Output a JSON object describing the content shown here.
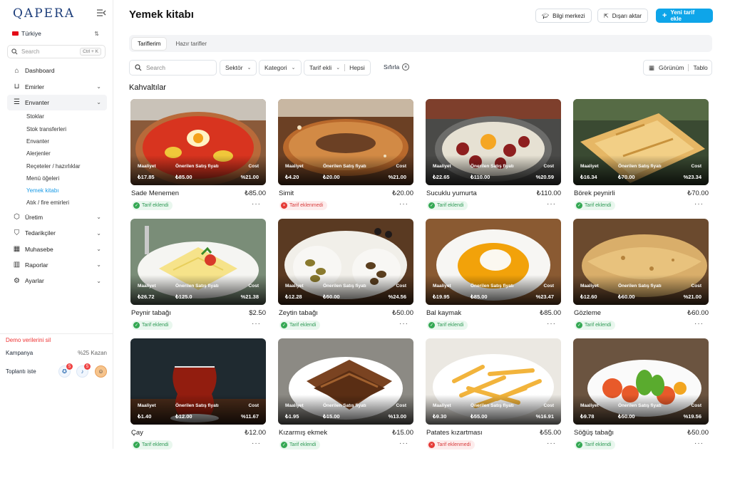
{
  "app": {
    "logo": "QAPERA"
  },
  "sidebar": {
    "country": "Türkiye",
    "search_placeholder": "Search",
    "search_shortcut": "Ctrl + K",
    "items": [
      {
        "label": "Dashboard",
        "icon": "home-icon",
        "chevron": false
      },
      {
        "label": "Emirler",
        "icon": "basket-icon",
        "chevron": true
      },
      {
        "label": "Envanter",
        "icon": "inventory-icon",
        "chevron": true,
        "expanded": true
      }
    ],
    "subitems": [
      "Stoklar",
      "Stok transferleri",
      "Envanter",
      "Alerjenler",
      "Reçeteler / hazırlıklar",
      "Menü öğeleri",
      "Yemek kitabı",
      "Atık / fire emirleri"
    ],
    "selected_sub": "Yemek kitabı",
    "items_after": [
      {
        "label": "Üretim",
        "icon": "box-icon"
      },
      {
        "label": "Tedarikçiler",
        "icon": "supplier-icon"
      },
      {
        "label": "Muhasebe",
        "icon": "calculator-icon"
      },
      {
        "label": "Raporlar",
        "icon": "chart-icon"
      },
      {
        "label": "Ayarlar",
        "icon": "gear-icon"
      }
    ],
    "demo_label": "Demo verilerini sil",
    "campaign_label": "Kampanya",
    "campaign_value": "%25 Kazan",
    "meeting_label": "Toplantı iste",
    "badge_award": "5",
    "badge_bell": "5"
  },
  "header": {
    "title": "Yemek kitabı",
    "btn_info": "Bilgi merkezi",
    "btn_export": "Dışarı aktar",
    "btn_new": "Yeni tarif ekle"
  },
  "tabs": [
    "Tariflerim",
    "Hazır tarifler"
  ],
  "filters": {
    "search_placeholder": "Search",
    "sector": "Sektör",
    "category": "Kategori",
    "recipe_added": "Tarif ekli",
    "recipe_added_value": "Hepsi",
    "reset": "Sıfırla",
    "view": "Görünüm",
    "view_value": "Tablo"
  },
  "section": "Kahvaltılar",
  "metric_labels": {
    "cost_tr": "Maaliyet",
    "suggested": "Önerilen Satış fiyatı",
    "cost_pct": "Cost"
  },
  "colors": {
    "accent": "#0ea5e9",
    "ok": "#34a853",
    "error": "#e53935"
  },
  "recipes": [
    {
      "name": "Sade Menemen",
      "price": "₺85.00",
      "cost": "₺17.85",
      "suggested": "₺85.00",
      "pct": "%21.00",
      "status": "Tarif eklendi",
      "ok": true,
      "art": "menemen"
    },
    {
      "name": "Simit",
      "price": "₺20.00",
      "cost": "₺4.20",
      "suggested": "₺20.00",
      "pct": "%21.00",
      "status": "Tarif eklenmedi",
      "ok": false,
      "art": "simit"
    },
    {
      "name": "Sucuklu yumurta",
      "price": "₺110.00",
      "cost": "₺22.65",
      "suggested": "₺110.00",
      "pct": "%20.59",
      "status": "Tarif eklendi",
      "ok": true,
      "art": "sucuk"
    },
    {
      "name": "Börek peynirli",
      "price": "₺70.00",
      "cost": "₺16.34",
      "suggested": "₺70.00",
      "pct": "%23.34",
      "status": "Tarif eklendi",
      "ok": true,
      "art": "borek"
    },
    {
      "name": "Peynir tabağı",
      "price": "$2.50",
      "cost": "₺26.72",
      "suggested": "₺125.0",
      "pct": "%21.38",
      "status": "Tarif eklendi",
      "ok": true,
      "art": "peynir"
    },
    {
      "name": "Zeytin tabağı",
      "price": "₺50.00",
      "cost": "₺12.28",
      "suggested": "₺50.00",
      "pct": "%24.56",
      "status": "Tarif eklendi",
      "ok": true,
      "art": "zeytin"
    },
    {
      "name": "Bal kaymak",
      "price": "₺85.00",
      "cost": "₺19.95",
      "suggested": "₺85.00",
      "pct": "%23.47",
      "status": "Tarif eklendi",
      "ok": true,
      "art": "bal"
    },
    {
      "name": "Gözleme",
      "price": "₺60.00",
      "cost": "₺12.60",
      "suggested": "₺60.00",
      "pct": "%21.00",
      "status": "Tarif eklendi",
      "ok": true,
      "art": "gozleme"
    },
    {
      "name": "Çay",
      "price": "₺12.00",
      "cost": "₺1.40",
      "suggested": "₺12.00",
      "pct": "%11.67",
      "status": "Tarif eklendi",
      "ok": true,
      "art": "cay"
    },
    {
      "name": "Kızarmış ekmek",
      "price": "₺15.00",
      "cost": "₺1.95",
      "suggested": "₺15.00",
      "pct": "%13.00",
      "status": "Tarif eklendi",
      "ok": true,
      "art": "ekmek"
    },
    {
      "name": "Patates kızartması",
      "price": "₺55.00",
      "cost": "₺9.30",
      "suggested": "₺55.00",
      "pct": "%16.91",
      "status": "Tarif eklenmedi",
      "ok": false,
      "art": "patates"
    },
    {
      "name": "Söğüş tabağı",
      "price": "₺50.00",
      "cost": "₺9.78",
      "suggested": "₺50.00",
      "pct": "%19.56",
      "status": "Tarif eklendi",
      "ok": true,
      "art": "sogus"
    }
  ]
}
